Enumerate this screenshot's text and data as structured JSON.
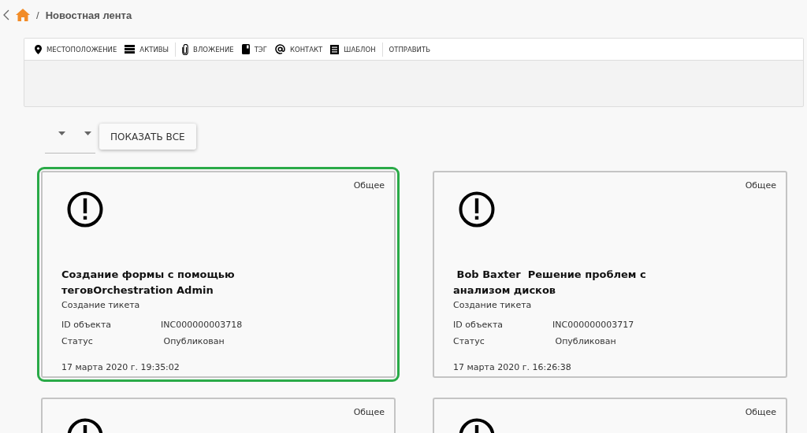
{
  "breadcrumb": {
    "separator": "/",
    "title": "Новостная лента"
  },
  "toolbar": {
    "items": [
      {
        "kind": "location",
        "label": "МЕСТОПОЛОЖЕНИЕ"
      },
      {
        "kind": "assets",
        "label": "АКТИВЫ"
      },
      {
        "kind": "divider"
      },
      {
        "kind": "attachment",
        "label": "ВЛОЖЕНИЕ"
      },
      {
        "kind": "tag",
        "label": "ТЭГ"
      },
      {
        "kind": "contact",
        "label": "КОНТАКТ"
      },
      {
        "kind": "template",
        "label": "ШАБЛОН"
      },
      {
        "kind": "divider"
      },
      {
        "kind": "send",
        "label": "ОТПРАВИТЬ"
      }
    ]
  },
  "filter": {
    "show_all_button": "ПОКАЗАТЬ ВСЕ"
  },
  "cards": [
    {
      "selected": true,
      "category": "Общее",
      "title": "Создание формы с помощью теговOrchestration Admin",
      "subtitle": "Создание тикета",
      "fields": [
        {
          "label": "ID объекта",
          "value": "INC000000003718"
        },
        {
          "label": "Статус",
          "value": " Опубликован"
        }
      ],
      "date": "17 марта 2020 г. 19:35:02"
    },
    {
      "selected": false,
      "category": "Общее",
      "title": " Bob Baxter  Решение проблем с анализом дисков",
      "subtitle": "Создание тикета",
      "fields": [
        {
          "label": "ID объекта",
          "value": "INC000000003717"
        },
        {
          "label": "Статус",
          "value": " Опубликован"
        }
      ],
      "date": "17 марта 2020 г. 16:26:38"
    },
    {
      "selected": false,
      "category": "Общее"
    },
    {
      "selected": false,
      "category": "Общее"
    }
  ]
}
